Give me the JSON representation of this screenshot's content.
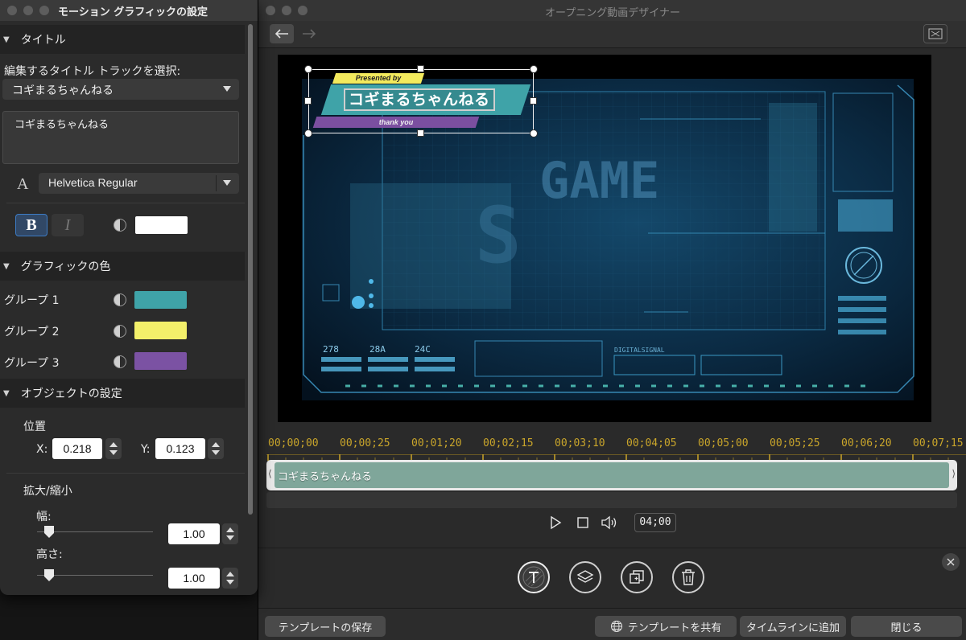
{
  "main_window": {
    "title": "オープニング動画デザイナー",
    "overlay": {
      "presented_by": "Presented by",
      "name": "コギまるちゃんねる",
      "thank_you": "thank you"
    },
    "timeline": {
      "ruler_labels": [
        "00;00;00",
        "00;00;25",
        "00;01;20",
        "00;02;15",
        "00;03;10",
        "00;04;05",
        "00;05;00",
        "00;05;25",
        "00;06;20",
        "00;07;15"
      ],
      "clip_label": "コギまるちゃんねる"
    },
    "playback": {
      "timecode": "04;00"
    },
    "buttons": {
      "save_template": "テンプレートの保存",
      "share_template": "テンプレートを共有",
      "add_to_timeline": "タイムラインに追加",
      "close": "閉じる"
    }
  },
  "settings_panel": {
    "title": "モーション グラフィックの設定",
    "title_section": {
      "header": "タイトル",
      "track_select_label": "編集するタイトル トラックを選択:",
      "track_selected": "コギまるちゃんねる",
      "text_value": "コギまるちゃんねる",
      "font": "Helvetica Regular",
      "bold_label": "B",
      "italic_label": "I",
      "text_color": "#ffffff"
    },
    "graphic_colors": {
      "header": "グラフィックの色",
      "groups": [
        {
          "label": "グループ 1",
          "color": "#3fa3a8"
        },
        {
          "label": "グループ 2",
          "color": "#f3f06a"
        },
        {
          "label": "グループ 3",
          "color": "#7b52a3"
        }
      ]
    },
    "object_settings": {
      "header": "オブジェクトの設定",
      "position_label": "位置",
      "x_label": "X:",
      "x_value": "0.218",
      "y_label": "Y:",
      "y_value": "0.123",
      "scale_label": "拡大/縮小",
      "width_label": "幅:",
      "width_value": "1.00",
      "height_label": "高さ:",
      "height_value": "1.00"
    }
  },
  "colors": {
    "accent_gold": "#c9a52a",
    "clip": "#7fa69a"
  }
}
